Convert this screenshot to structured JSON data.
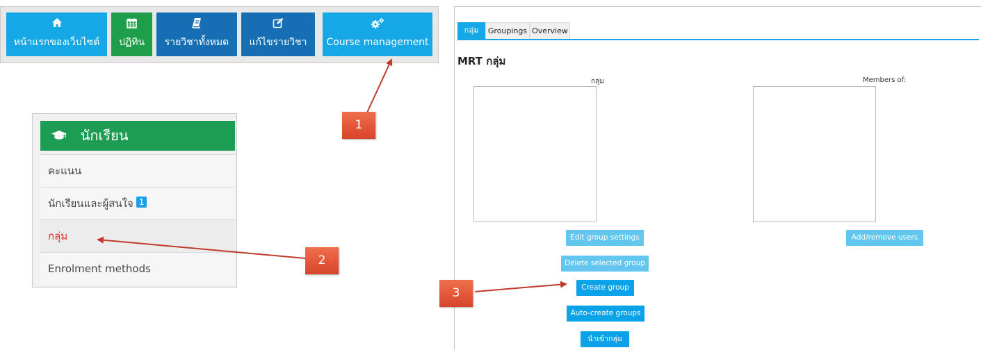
{
  "nav": {
    "home_label": "หน้าแรกของเว็บไซต์",
    "calendar_label": "ปฏิทิน",
    "all_courses_label": "รายวิชาทั้งหมด",
    "edit_course_label": "แก้ไขรายวิชา",
    "course_management_label": "Course management",
    "icons": [
      "home-icon",
      "calendar-icon",
      "book-icon",
      "edit-icon",
      "cogs-icon"
    ],
    "colors": {
      "home": "#16a7e6",
      "calendar": "#1e9e4a",
      "courses": "#166fb3",
      "management": "#16a7e6"
    }
  },
  "student_menu": {
    "title": "นักเรียน",
    "title_icon": "graduation-cap-icon",
    "items": [
      {
        "label": "คะแนน"
      },
      {
        "label": "นักเรียนและผู้สนใจ",
        "badge": "1"
      },
      {
        "label": "กลุ่ม",
        "active": true
      },
      {
        "label": "Enrolment methods"
      }
    ],
    "header_color": "#1d9c53",
    "active_color": "#e0272a"
  },
  "markers": [
    "1",
    "2",
    "3"
  ],
  "groups_page": {
    "tabs": [
      {
        "label": "กลุ่ม",
        "active": true
      },
      {
        "label": "Groupings"
      },
      {
        "label": "Overview"
      }
    ],
    "title": "MRT กลุ่ม",
    "groups_header": "กลุ่ม",
    "members_header": "Members of:",
    "buttons": {
      "edit_group_settings": "Edit group settings",
      "delete_selected_group": "Delete selected group",
      "create_group": "Create group",
      "auto_create_groups": "Auto-create groups",
      "import_groups": "นำเข้ากลุ่ม",
      "add_remove_users": "Add/remove users"
    },
    "accent_color": "#16a7e6"
  }
}
